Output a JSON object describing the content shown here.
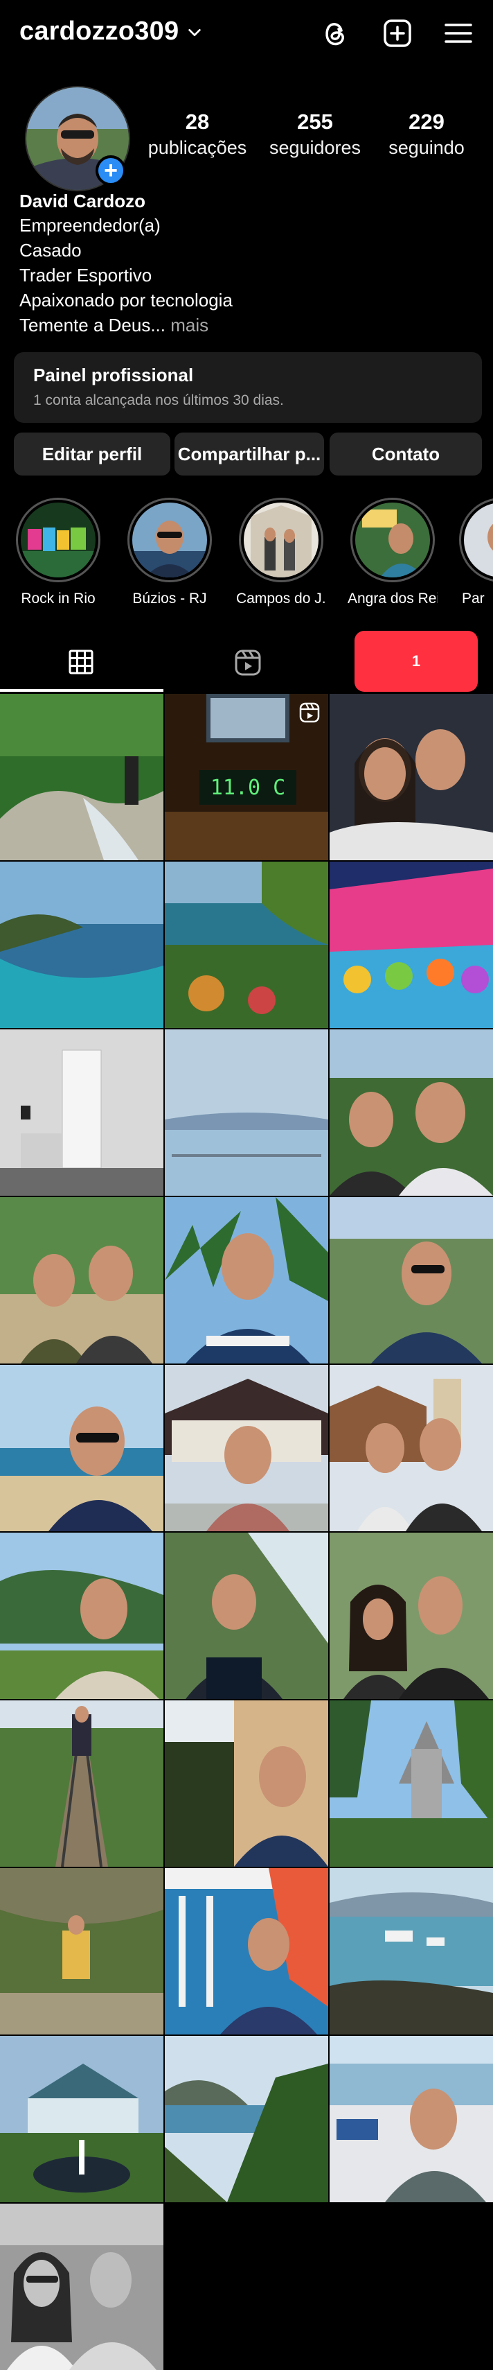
{
  "header": {
    "username": "cardozzo309",
    "icons": [
      "chevron-down-icon",
      "threads-icon",
      "create-icon",
      "menu-icon"
    ]
  },
  "profile": {
    "stats": [
      {
        "value": "28",
        "label": "publicações"
      },
      {
        "value": "255",
        "label": "seguidores"
      },
      {
        "value": "229",
        "label": "seguindo"
      }
    ],
    "name": "David Cardozo",
    "bio_lines": [
      "Empreendedor(a)",
      "Casado",
      "Trader Esportivo",
      "Apaixonado por tecnologia"
    ],
    "bio_last": "Temente a Deus...",
    "bio_more": " mais"
  },
  "panel": {
    "title": "Painel profissional",
    "subtitle": "1 conta alcançada nos últimos 30 dias."
  },
  "buttons": {
    "edit": "Editar perfil",
    "share": "Compartilhar p...",
    "contact": "Contato"
  },
  "highlights": [
    {
      "label": "Rock in Rio"
    },
    {
      "label": "Búzios - RJ"
    },
    {
      "label": "Campos do J..."
    },
    {
      "label": "Angra dos Reis"
    },
    {
      "label": "Par"
    }
  ],
  "tabs": {
    "active": "grid",
    "notification_count": "1"
  },
  "grid": {
    "post_count_shown": 28
  },
  "colors": {
    "background": "#000000",
    "button": "#262626",
    "badge": "#ff3040",
    "accent": "#2a8cf5"
  }
}
